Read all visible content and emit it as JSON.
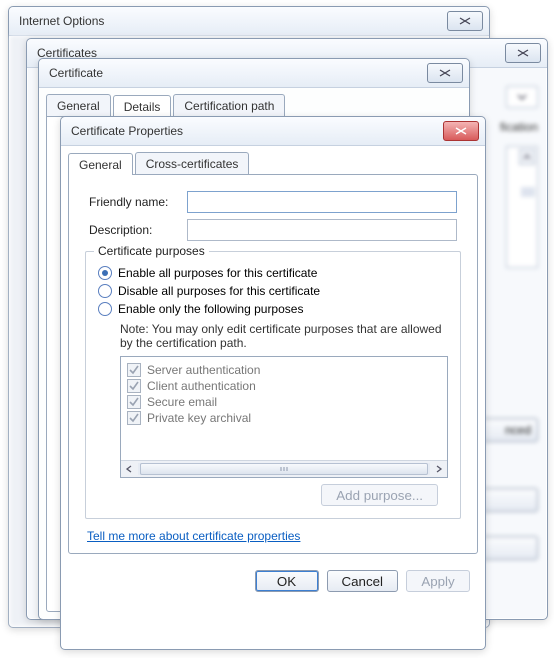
{
  "windows": {
    "internet_options": {
      "title": "Internet Options"
    },
    "certificates": {
      "title": "Certificates"
    },
    "certificate": {
      "title": "Certificate",
      "tabs": {
        "general": "General",
        "details": "Details",
        "certpath": "Certification path"
      }
    },
    "peek": {
      "tab_fication": "fication",
      "btn_nced": "nced"
    }
  },
  "dialog": {
    "title": "Certificate Properties",
    "tabs": {
      "general": "General",
      "cross": "Cross-certificates"
    },
    "fields": {
      "friendly_label": "Friendly name:",
      "friendly_value": "",
      "description_label": "Description:",
      "description_value": ""
    },
    "group": {
      "legend": "Certificate purposes",
      "radios": {
        "enable_all": "Enable all purposes for this certificate",
        "disable_all": "Disable all purposes for this certificate",
        "enable_only": "Enable only the following purposes"
      },
      "selected": "enable_all",
      "note": "Note: You may only edit certificate purposes that are allowed by the certification path.",
      "purposes": [
        "Server authentication",
        "Client authentication",
        "Secure email",
        "Private key archival"
      ],
      "add_purpose": "Add purpose..."
    },
    "help_link": "Tell me more about certificate properties",
    "buttons": {
      "ok": "OK",
      "cancel": "Cancel",
      "apply": "Apply"
    }
  }
}
